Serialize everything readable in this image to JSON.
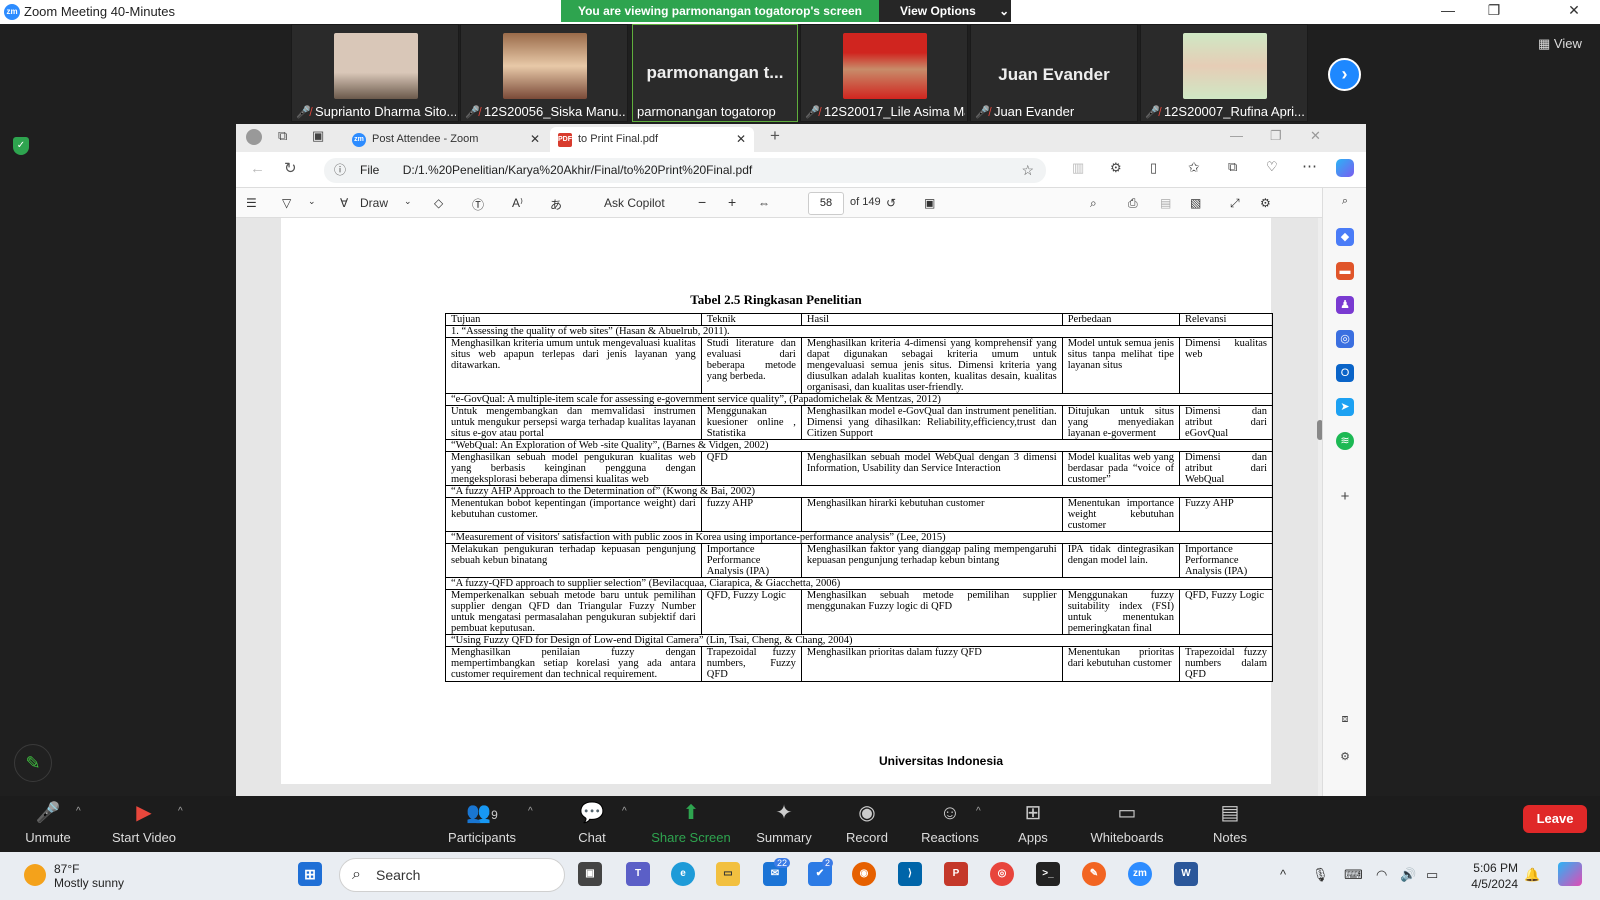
{
  "window": {
    "title": "Zoom Meeting 40-Minutes"
  },
  "share_banner": {
    "text": "You are viewing parmonangan togatorop's screen",
    "view_options": "View Options"
  },
  "participants": [
    {
      "label": "Suprianto Dharma Sito...",
      "has_video": true,
      "muted": true
    },
    {
      "label": "12S20056_Siska Manu...",
      "has_video": true,
      "muted": true
    },
    {
      "label": "parmonangan togatorop",
      "big_name": "parmonangan t...",
      "has_video": false,
      "muted": false
    },
    {
      "label": "12S20017_Lile Asima Ma...",
      "has_video": true,
      "muted": true
    },
    {
      "label": "Juan Evander",
      "big_name": "Juan Evander",
      "has_video": false,
      "muted": true
    },
    {
      "label": "12S20007_Rufina Apri...",
      "has_video": true,
      "muted": true
    }
  ],
  "view_button": "View",
  "browser": {
    "tabs": [
      {
        "label": "Post Attendee - Zoom",
        "icon": "zoom-icon",
        "active": false
      },
      {
        "label": "to Print Final.pdf",
        "icon": "pdf-icon",
        "active": true
      }
    ],
    "address_prefix": "File",
    "url": "D:/1.%20Penelitian/Karya%20Akhir/Final/to%20Print%20Final.pdf"
  },
  "pdf_toolbar": {
    "draw": "Draw",
    "ask_copilot": "Ask Copilot",
    "page": "58",
    "of_pages": "of 149"
  },
  "document": {
    "table_title": "Tabel 2.5 Ringkasan Penelitian",
    "headers": [
      "Tujuan",
      "Teknik",
      "Hasil",
      "Perbedaan",
      "Relevansi"
    ],
    "sections": [
      {
        "title": "1.   “Assessing the quality of web sites” (Hasan & Abuelrub, 2011).",
        "row": [
          "Menghasilkan kriteria umum untuk mengevaluasi kualitas situs web apapun terlepas dari jenis layanan yang ditawarkan.",
          "Studi literature dan evaluasi dari beberapa metode yang berbeda.",
          "Menghasilkan kriteria 4-dimensi yang komprehensif yang dapat digunakan sebagai kriteria umum untuk mengevaluasi semua jenis situs. Dimensi kriteria yang diusulkan adalah kualitas konten, kualitas desain, kualitas organisasi, dan kualitas user-friendly.",
          "Model untuk semua jenis situs tanpa melihat tipe layanan situs",
          "Dimensi kualitas web"
        ]
      },
      {
        "title": "“e-GovQual: A multiple-item scale for assessing e-government service quality”, (Papadomichelak & Mentzas, 2012)",
        "row": [
          "Untuk mengembangkan dan memvalidasi instrumen untuk mengukur persepsi warga terhadap kualitas layanan situs e-gov atau portal",
          "Menggunakan kuesioner online , Statistika",
          "Menghasilkan model e-GovQual dan instrument penelitian. Dimensi yang dihasilkan: Reliability,efficiency,trust dan Citizen Support",
          "Ditujukan untuk situs yang menyediakan layanan e-goverment",
          "Dimensi dan atribut dari eGovQual"
        ]
      },
      {
        "title": "“WebQual: An Exploration of Web -site Quality”, (Barnes & Vidgen, 2002)",
        "row": [
          "Menghasilkan sebuah model pengukuran kualitas web yang berbasis keinginan pengguna dengan mengeksplorasi beberapa dimensi kualitas web",
          "QFD",
          "Menghasilkan sebuah model WebQual dengan 3 dimensi Information, Usability dan Service  Interaction",
          "Model kualitas web yang berdasar pada “voice of customer”",
          "Dimensi dan atribut dari WebQual"
        ]
      },
      {
        "title": "“A fuzzy AHP Approach to the Determination of” (Kwong & Bai, 2002)",
        "row": [
          "Menentukan bobot kepentingan (importance weight) dari kebutuhan customer.",
          "fuzzy AHP",
          "Menghasilkan hirarki kebutuhan customer",
          "Menentukan importance weight kebutuhan customer",
          "Fuzzy AHP"
        ]
      },
      {
        "title": "“Measurement of visitors' satisfaction with public zoos in Korea using importance-performance analysis” (Lee, 2015)",
        "row": [
          "Melakukan pengukuran terhadap kepuasan pengunjung sebuah kebun binatang",
          "Importance Performance Analysis (IPA)",
          "Menghasilkan faktor yang dianggap paling mempengaruhi kepuasan pengunjung terhadap kebun bintang",
          "IPA tidak dintegrasikan dengan model lain.",
          "Importance Performance Analysis (IPA)"
        ]
      },
      {
        "title": "“A fuzzy-QFD approach to supplier selection” (Bevilacquaa, Ciarapica, & Giacchetta, 2006)",
        "row": [
          "Memperkenalkan sebuah metode baru untuk pemilihan supplier dengan QFD dan Triangular Fuzzy Number untuk mengatasi permasalahan pengukuran subjektif dari pembuat keputusan.",
          "QFD, Fuzzy Logic",
          "Menghasilkan sebuah metode pemilihan supplier menggunakan Fuzzy logic di QFD",
          "Menggunakan fuzzy suitability index (FSI) untuk menentukan pemeringkatan final",
          "QFD, Fuzzy Logic"
        ]
      },
      {
        "title": "“Using Fuzzy QFD for Design of Low-end Digital Camera” (Lin, Tsai, Cheng, & Chang, 2004)",
        "row": [
          "Menghasilkan penilaian fuzzy dengan mempertimbangkan setiap korelasi yang ada antara customer requirement dan technical requirement.",
          "Trapezoidal fuzzy numbers, Fuzzy QFD",
          "Menghasilkan prioritas dalam fuzzy QFD",
          "Menentukan prioritas dari kebutuhan customer",
          "Trapezoidal fuzzy numbers dalam QFD"
        ]
      }
    ],
    "footer": "Universitas Indonesia"
  },
  "controls": {
    "unmute": "Unmute",
    "start_video": "Start Video",
    "participants": "Participants",
    "participants_count": "9",
    "chat": "Chat",
    "share_screen": "Share Screen",
    "summary": "Summary",
    "record": "Record",
    "reactions": "Reactions",
    "apps": "Apps",
    "whiteboards": "Whiteboards",
    "notes": "Notes",
    "leave": "Leave"
  },
  "taskbar": {
    "temp": "87°F",
    "weather": "Mostly sunny",
    "search": "Search",
    "mail_badge": "22",
    "todo_badge": "2",
    "time": "5:06 PM",
    "date": "4/5/2024"
  },
  "colors": {
    "zoom_blue": "#2d8cff",
    "share_green": "#2ea44f",
    "leave_red": "#e02828"
  }
}
